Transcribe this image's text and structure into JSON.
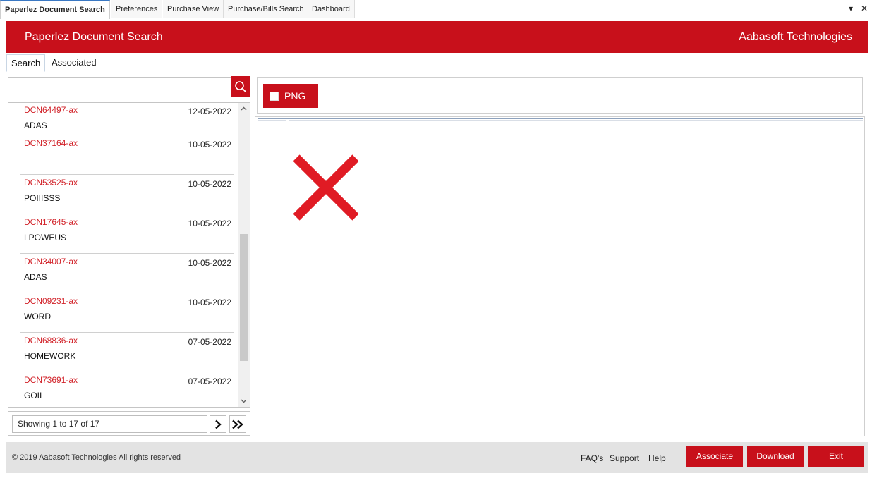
{
  "doc_tabs": [
    {
      "label": "Paperlez Document Search",
      "active": true
    },
    {
      "label": "Preferences",
      "active": false
    },
    {
      "label": "Purchase View",
      "active": false
    },
    {
      "label": "Purchase/Bills Search",
      "active": false
    },
    {
      "label": "Dashboard",
      "active": false
    }
  ],
  "window_controls": {
    "dropdown": "▾",
    "close": "✕"
  },
  "header": {
    "title": "Paperlez Document Search",
    "company": "Aabasoft Technologies"
  },
  "sub_tabs": [
    {
      "label": "Search",
      "active": true
    },
    {
      "label": "Associated",
      "active": false
    }
  ],
  "search": {
    "value": "",
    "placeholder": ""
  },
  "documents": [
    {
      "code": "DCN64497-ax",
      "date": "12-05-2022",
      "desc": "ADAS"
    },
    {
      "code": "DCN37164-ax",
      "date": "10-05-2022",
      "desc": ""
    },
    {
      "code": "DCN53525-ax",
      "date": "10-05-2022",
      "desc": "POIIISSS"
    },
    {
      "code": "DCN17645-ax",
      "date": "10-05-2022",
      "desc": "LPOWEUS"
    },
    {
      "code": "DCN34007-ax",
      "date": "10-05-2022",
      "desc": "ADAS"
    },
    {
      "code": "DCN09231-ax",
      "date": "10-05-2022",
      "desc": "WORD"
    },
    {
      "code": "DCN68836-ax",
      "date": "07-05-2022",
      "desc": "HOMEWORK"
    },
    {
      "code": "DCN73691-ax",
      "date": "07-05-2022",
      "desc": "GOII"
    }
  ],
  "pager": {
    "text": "Showing 1 to 17 of 17",
    "next_glyph": "›",
    "last_glyph": "»"
  },
  "viewer": {
    "toggle_label": "PNG",
    "toggle_checked": false
  },
  "footer": {
    "copyright": "© 2019 Aabasoft Technologies All rights reserved",
    "links": [
      "FAQ's",
      "Support",
      "Help"
    ],
    "buttons": {
      "associate": "Associate",
      "download": "Download",
      "exit": "Exit"
    }
  },
  "colors": {
    "brand_red": "#c8101b",
    "code_red": "#d2232a",
    "footer_grey": "#e3e3e3"
  },
  "icons": {
    "search": "magnifier-icon",
    "broken_image": "red-x-icon"
  }
}
